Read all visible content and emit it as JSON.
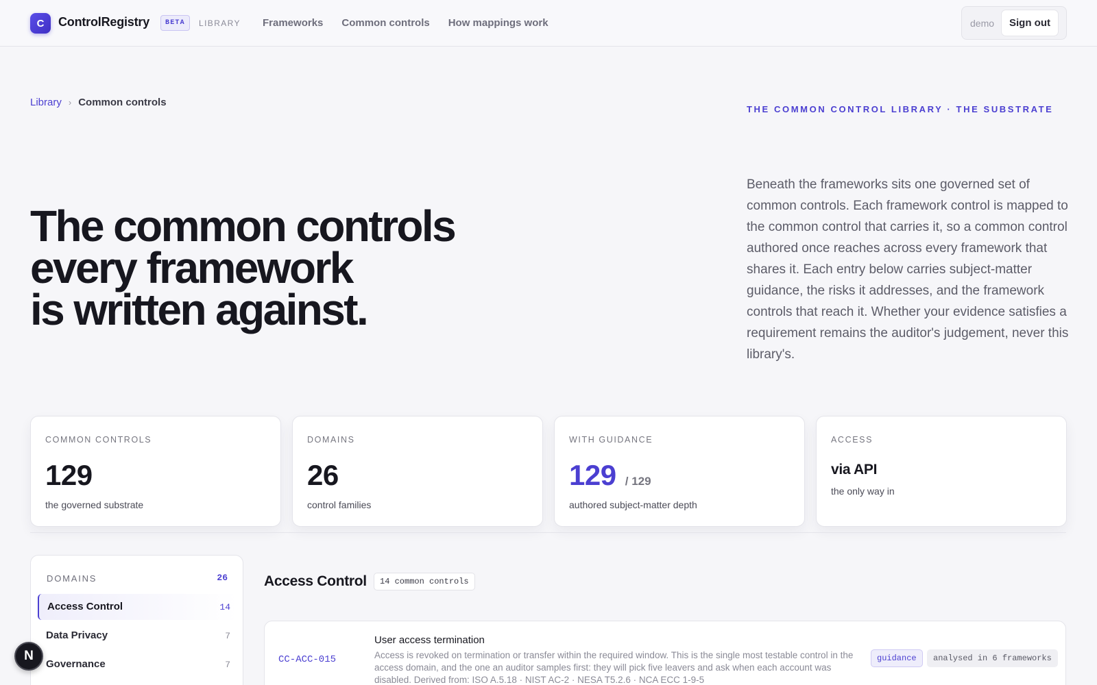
{
  "header": {
    "logo_letter": "C",
    "brand": "ControlRegistry",
    "beta_badge": "BETA",
    "section_tag": "LIBRARY",
    "nav": [
      "Frameworks",
      "Common controls",
      "How mappings work"
    ],
    "user": "demo",
    "sign_out": "Sign out"
  },
  "breadcrumb": {
    "root": "Library",
    "separator": "›",
    "current": "Common controls"
  },
  "hero": {
    "eyebrow": "THE COMMON CONTROL LIBRARY · THE SUBSTRATE",
    "title_lines": [
      "The common controls",
      "every framework",
      "is written against."
    ],
    "description": "Beneath the frameworks sits one governed set of common controls. Each framework control is mapped to the common control that carries it, so a common control authored once reaches across every framework that shares it. Each entry below carries subject-matter guidance, the risks it addresses, and the framework controls that reach it. Whether your evidence satisfies a requirement remains the auditor's judgement, never this library's."
  },
  "stats": [
    {
      "label": "COMMON CONTROLS",
      "value": "129",
      "sub": "the governed substrate"
    },
    {
      "label": "DOMAINS",
      "value": "26",
      "sub": "control families"
    },
    {
      "label": "WITH GUIDANCE",
      "value": "129",
      "of": "/ 129",
      "sub": "authored subject-matter depth"
    },
    {
      "label": "ACCESS",
      "value": "via API",
      "sub": "the only way in"
    }
  ],
  "domains": {
    "heading": "DOMAINS",
    "count": "26",
    "items": [
      {
        "name": "Access Control",
        "count": "14"
      },
      {
        "name": "Data Privacy",
        "count": "7"
      },
      {
        "name": "Governance",
        "count": "7"
      }
    ]
  },
  "main": {
    "section_title": "Access Control",
    "section_count": "14 common controls",
    "controls": [
      {
        "id": "CC-ACC-015",
        "name": "User access termination",
        "description": "Access is revoked on termination or transfer within the required window. This is the single most testable control in the access domain, and the one an auditor samples first: they will pick five leavers and ask when each account was disabled. Derived from: ISO A.5.18 · NIST AC-2 · NESA T5.2.6 · NCA ECC 1-9-5",
        "tags": [
          "guidance",
          "analysed in 6 frameworks"
        ]
      }
    ]
  },
  "fab_letter": "N",
  "colors": {
    "accent": "#4b3fd1",
    "ink": "#17171f",
    "background": "#f6f6f9"
  }
}
